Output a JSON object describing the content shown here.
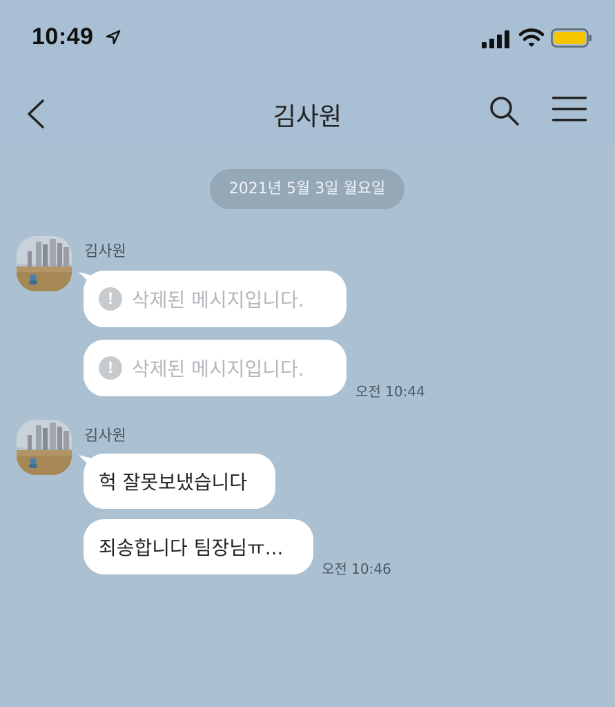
{
  "status_bar": {
    "time": "10:49",
    "icons": [
      "location-arrow-icon",
      "signal-icon",
      "wifi-icon",
      "battery-icon"
    ],
    "battery_color": "#f7c400"
  },
  "header": {
    "title": "김사원",
    "back_icon": "chevron-left-icon",
    "search_icon": "search-icon",
    "menu_icon": "hamburger-menu-icon"
  },
  "chat": {
    "date_divider": "2021년 5월 3일 월요일",
    "groups": [
      {
        "sender": "김사원",
        "messages": [
          {
            "text": "삭제된 메시지입니다.",
            "deleted": true
          },
          {
            "text": "삭제된 메시지입니다.",
            "deleted": true
          }
        ],
        "timestamp": "오전 10:44"
      },
      {
        "sender": "김사원",
        "messages": [
          {
            "text": "헉 잘못보냈습니다",
            "deleted": false
          },
          {
            "text": "죄송합니다 팀장님ㅠ...",
            "deleted": false
          }
        ],
        "timestamp": "오전 10:46"
      }
    ]
  },
  "colors": {
    "chat_background": "#abc1d1",
    "header_background": "#a9bfd4",
    "bubble": "#ffffff",
    "date_pill": "#95a8b8"
  }
}
